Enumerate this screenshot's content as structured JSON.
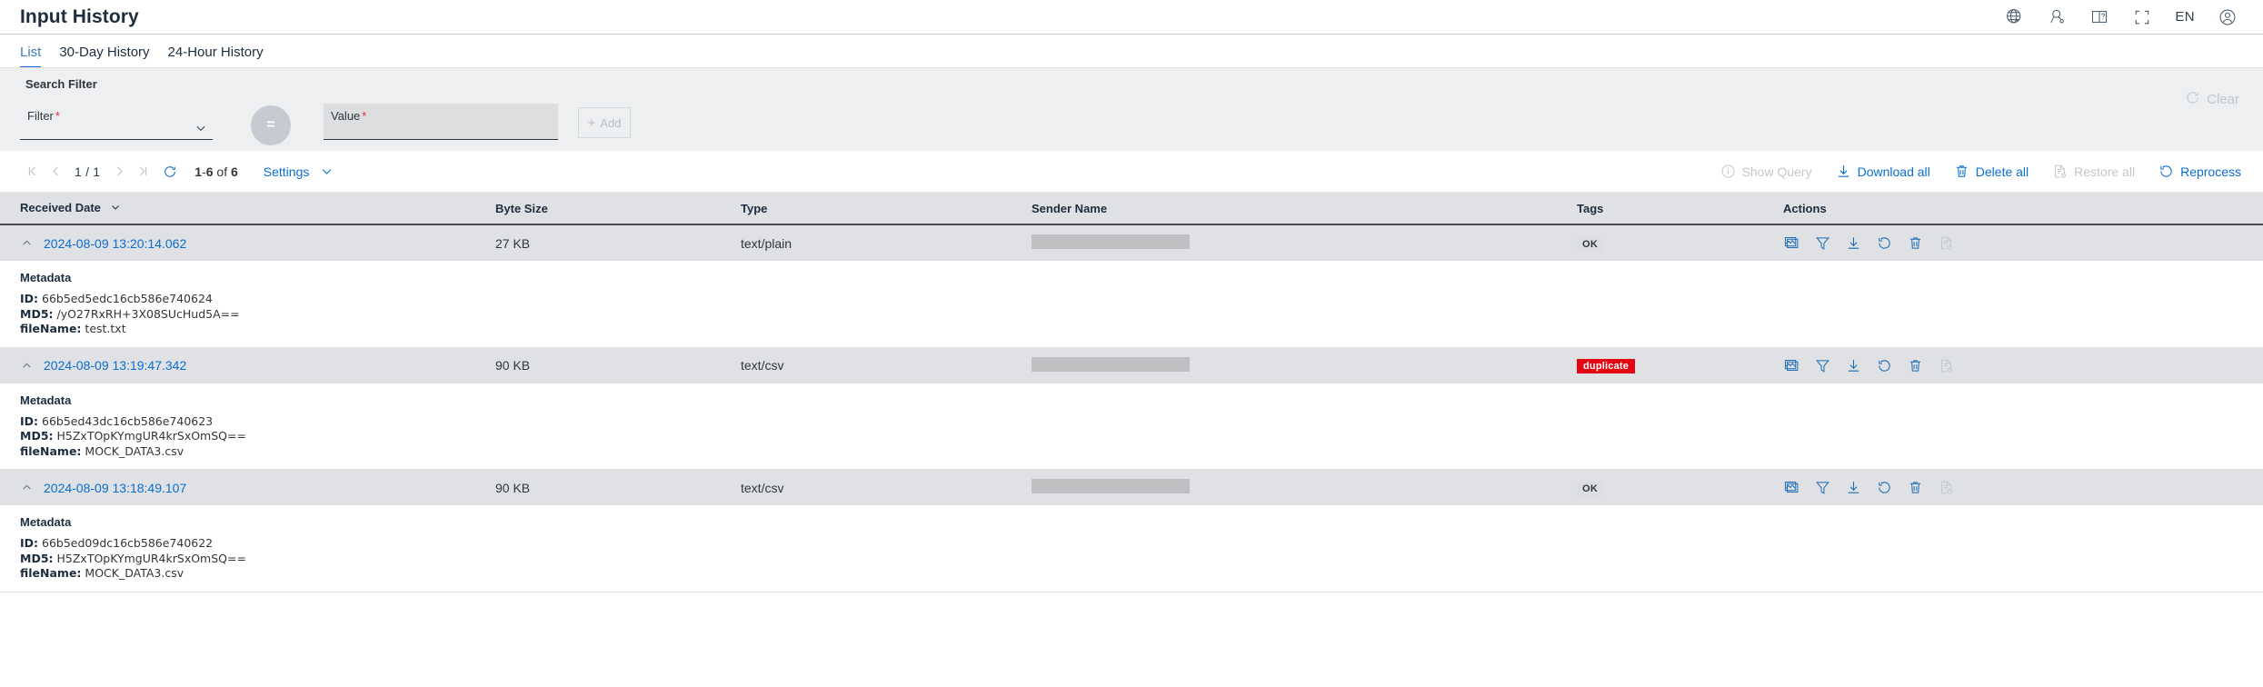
{
  "header": {
    "title": "Input History",
    "language": "EN",
    "icons": [
      {
        "name": "globe-icon",
        "label": "Language / Region"
      },
      {
        "name": "support-person-icon",
        "label": "Support"
      },
      {
        "name": "book-help-icon",
        "label": "Help"
      },
      {
        "name": "fullscreen-icon",
        "label": "Full Screen"
      },
      {
        "name": "user-account-icon",
        "label": "Account"
      }
    ]
  },
  "tabs": [
    {
      "label": "List",
      "active": true
    },
    {
      "label": "30-Day History",
      "active": false
    },
    {
      "label": "24-Hour History",
      "active": false
    }
  ],
  "search_filter": {
    "section_title": "Search Filter",
    "filter_label": "Filter",
    "filter_required": "*",
    "filter_value": "",
    "operator": "=",
    "value_label": "Value",
    "value_required": "*",
    "value_value": "",
    "add_label": "Add",
    "clear_label": "Clear"
  },
  "toolbar": {
    "page_indicator": "1 / 1",
    "range_first": "1",
    "range_sep": "-",
    "range_last": "6",
    "range_of": "of",
    "range_total": "6",
    "settings_label": "Settings",
    "actions": [
      {
        "label": "Show Query",
        "icon": "info-circle-icon",
        "enabled": false
      },
      {
        "label": "Download all",
        "icon": "download-icon",
        "enabled": true
      },
      {
        "label": "Delete all",
        "icon": "trash-icon",
        "enabled": true
      },
      {
        "label": "Restore all",
        "icon": "restore-document-icon",
        "enabled": false
      },
      {
        "label": "Reprocess",
        "icon": "reprocess-icon",
        "enabled": true
      }
    ]
  },
  "table": {
    "columns": [
      {
        "label": "Received Date",
        "sortable": true
      },
      {
        "label": "Byte Size",
        "sortable": false
      },
      {
        "label": "Type",
        "sortable": false
      },
      {
        "label": "Sender Name",
        "sortable": false
      },
      {
        "label": "Tags",
        "sortable": false
      },
      {
        "label": "Actions",
        "sortable": false
      }
    ],
    "rows": [
      {
        "received_date": "2024-08-09 13:20:14.062",
        "byte_size": "27 KB",
        "type": "text/plain",
        "sender_name": "",
        "tag": "OK",
        "tag_kind": "ok",
        "metadata": {
          "title": "Metadata",
          "id_label": "ID:",
          "id_value": "66b5ed5edc16cb586e740624",
          "md5_label": "MD5:",
          "md5_value": "/yO27RxRH+3X08SUcHud5A==",
          "filename_label": "fileName:",
          "filename_value": "test.txt"
        }
      },
      {
        "received_date": "2024-08-09 13:19:47.342",
        "byte_size": "90 KB",
        "type": "text/csv",
        "sender_name": "",
        "tag": "duplicate",
        "tag_kind": "duplicate",
        "metadata": {
          "title": "Metadata",
          "id_label": "ID:",
          "id_value": "66b5ed43dc16cb586e740623",
          "md5_label": "MD5:",
          "md5_value": "H5ZxTOpKYmgUR4krSxOmSQ==",
          "filename_label": "fileName:",
          "filename_value": "MOCK_DATA3.csv"
        }
      },
      {
        "received_date": "2024-08-09 13:18:49.107",
        "byte_size": "90 KB",
        "type": "text/csv",
        "sender_name": "",
        "tag": "OK",
        "tag_kind": "ok",
        "metadata": {
          "title": "Metadata",
          "id_label": "ID:",
          "id_value": "66b5ed09dc16cb586e740622",
          "md5_label": "MD5:",
          "md5_value": "H5ZxTOpKYmgUR4krSxOmSQ==",
          "filename_label": "fileName:",
          "filename_value": "MOCK_DATA3.csv"
        }
      }
    ],
    "row_actions": [
      {
        "name": "preview-icon",
        "enabled": true
      },
      {
        "name": "filter-funnel-icon",
        "enabled": true
      },
      {
        "name": "download-icon",
        "enabled": true
      },
      {
        "name": "restore-icon",
        "enabled": true
      },
      {
        "name": "delete-icon",
        "enabled": true
      },
      {
        "name": "reprocess-document-icon",
        "enabled": false
      }
    ]
  },
  "colors": {
    "accent_blue": "#0a6ed1",
    "link_blue": "#1a6bb5",
    "duplicate_red": "#e30613",
    "panel_gray": "#eeeff0",
    "row_gray": "#dfe1e4",
    "disabled_gray": "#c3c8cd",
    "required_red": "#e3263a"
  }
}
